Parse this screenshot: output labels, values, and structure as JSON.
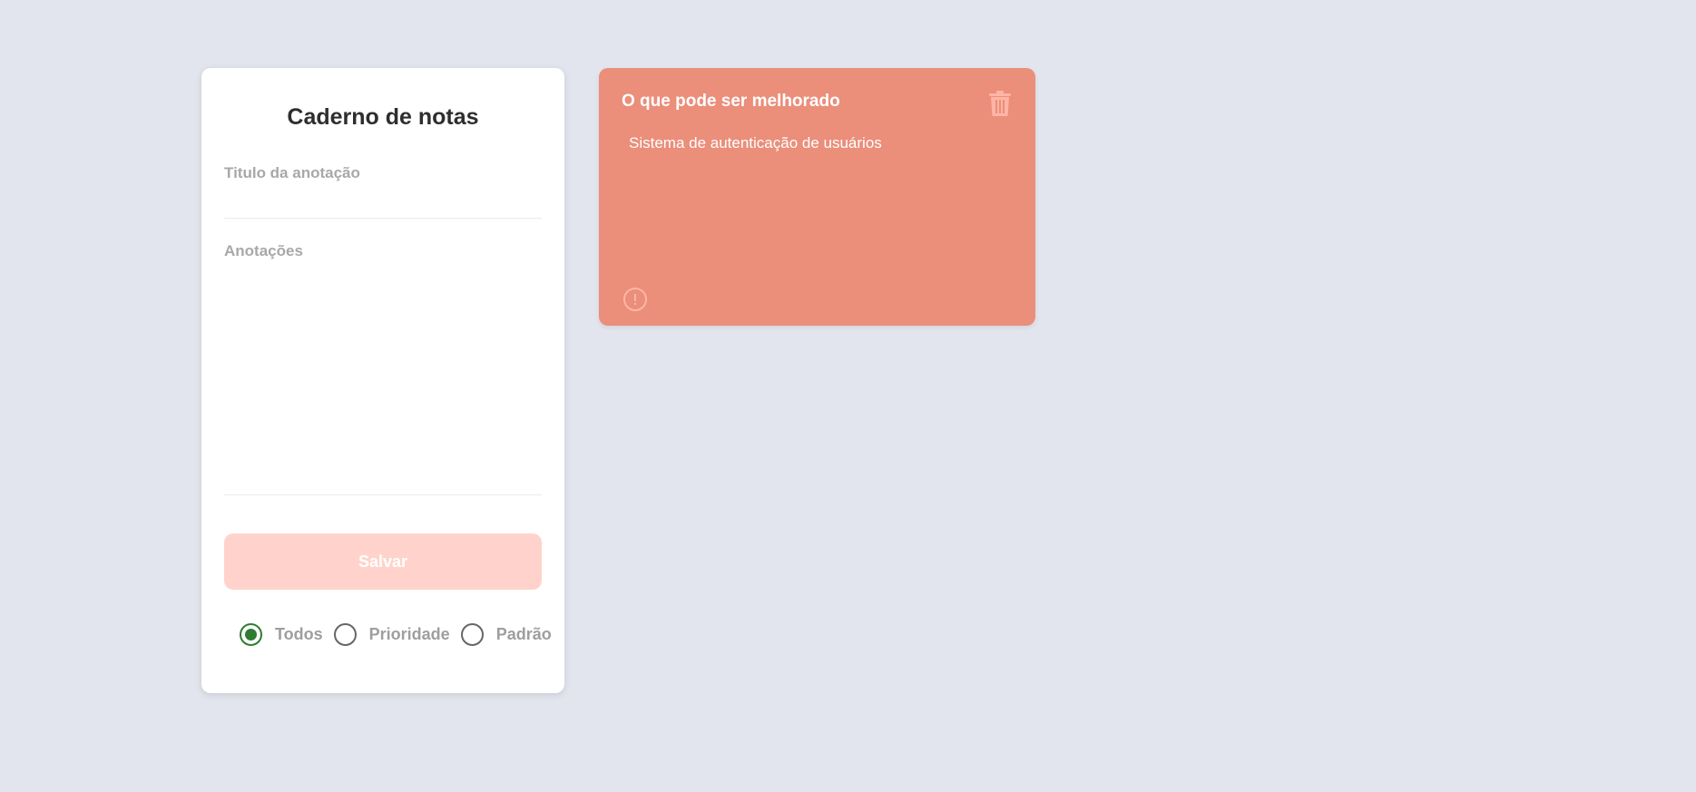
{
  "form": {
    "title": "Caderno de notas",
    "title_label": "Titulo da anotação",
    "title_value": "",
    "notes_label": "Anotações",
    "notes_value": "",
    "save_label": "Salvar"
  },
  "filters": {
    "selected": "Todos",
    "options": [
      {
        "label": "Todos",
        "checked": true
      },
      {
        "label": "Prioridade",
        "checked": false
      },
      {
        "label": "Padrão",
        "checked": false
      }
    ]
  },
  "notes": [
    {
      "title": "O que pode ser melhorado",
      "body": "Sistema de autenticação de usuários",
      "color": "#eb8e7a",
      "trash_icon": "trash-icon",
      "priority_icon": "alert-circle-icon"
    }
  ],
  "colors": {
    "background": "#e3e5ee",
    "save_button": "#ffd3cb",
    "radio_checked": "#2e7d32"
  }
}
